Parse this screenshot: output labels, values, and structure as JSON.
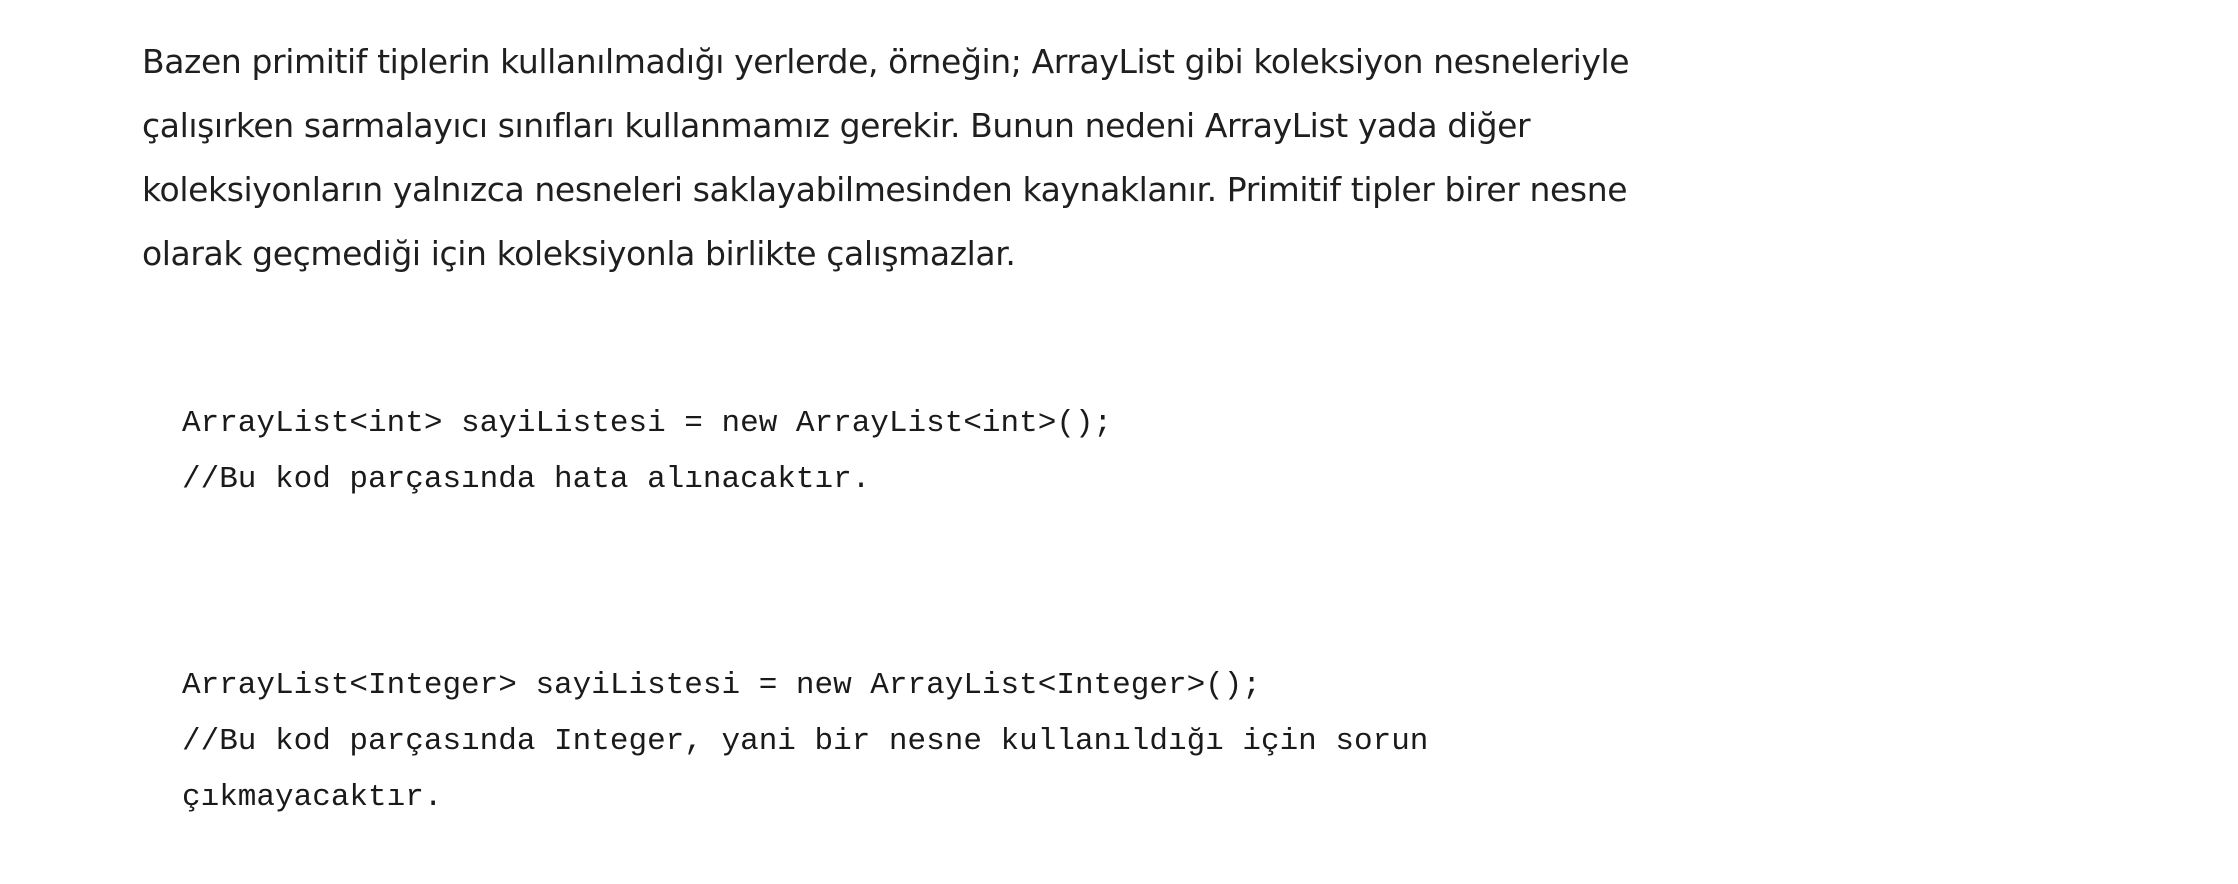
{
  "article": {
    "paragraph": "Bazen primitif tiplerin kullanılmadığı yerlerde, örneğin; ArrayList gibi koleksiyon nesneleriyle çalışırken sarmalayıcı sınıfları kullanmamız gerekir. Bunun nedeni ArrayList yada diğer koleksiyonların yalnızca nesneleri saklayabilmesinden kaynaklanır. Primitif tipler birer nesne olarak geçmediği için koleksiyonla birlikte çalışmazlar."
  },
  "code_examples": [
    {
      "lines": [
        "ArrayList<int> sayiListesi = new ArrayList<int>();",
        "//Bu kod parçasında hata alınacaktır."
      ]
    },
    {
      "lines": [
        "ArrayList<Integer> sayiListesi = new ArrayList<Integer>();",
        "//Bu kod parçasında Integer, yani bir nesne kullanıldığı için sorun",
        "çıkmayacaktır."
      ]
    }
  ]
}
